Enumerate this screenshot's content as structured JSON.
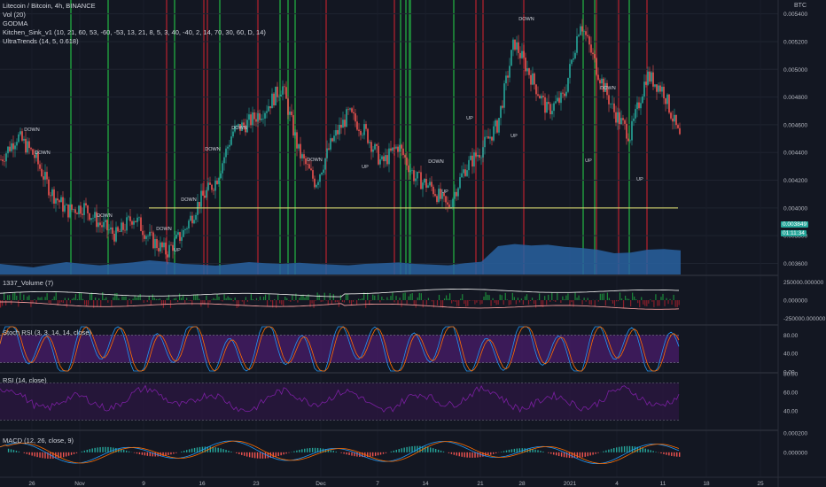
{
  "legend": {
    "symbol": "Litecoin / Bitcoin, 4h, BINANCE",
    "vol": "Vol (20)",
    "godma": "GODMA",
    "kitchen": "Kitchen_Sink_v1 (10, 21, 60, 53, -60, -53, 13, 21, 8, 5, 3, 40, -40, 2, 14, 70, 30, 60, D, 14)",
    "ultratrends": "UltraTrends (14, 5, 0.618)"
  },
  "axis_currency": "BTC",
  "panes": {
    "volume1337": "1337_Volume (7)",
    "stoch": "Stoch RSI (3, 3, 14, 14, close)",
    "rsi": "RSI (14, close)",
    "macd": "MACD (12, 26, close, 9)"
  },
  "price_tags": {
    "last_price": "0.003849",
    "countdown": "01:11:34"
  },
  "colors": {
    "background": "#131722",
    "bull": "#26a69a",
    "bear": "#ef5350",
    "green_band": "#1e8a3a",
    "red_band": "#8a1e2a",
    "volume": "#2962a0",
    "support": "#f0f07a",
    "stoch_fill": "#4a1c6b",
    "rsi_line": "#7b1fa2",
    "macd_line": "#2196f3",
    "signal_line": "#ff6d00"
  },
  "chart_data": [
    {
      "type": "line",
      "title": "Litecoin / Bitcoin, 4h, BINANCE",
      "x_ticks": [
        "26",
        "Nov",
        "9",
        "16",
        "23",
        "Dec",
        "7",
        "14",
        "21",
        "28",
        "2021",
        "4",
        "11",
        "18",
        "25"
      ],
      "y_ticks": [
        "0.005400",
        "0.005200",
        "0.005000",
        "0.004800",
        "0.004600",
        "0.004400",
        "0.004200",
        "0.004000",
        "0.003800",
        "0.003600"
      ],
      "ylim": [
        0.00352,
        0.0055
      ],
      "x_index": [
        0,
        10,
        20,
        30,
        40,
        50,
        60,
        70,
        80,
        90,
        100,
        110,
        120,
        130,
        140,
        150,
        160,
        170,
        180,
        190,
        200,
        210,
        220,
        230,
        240,
        250,
        260,
        270,
        280,
        290,
        300,
        310,
        320,
        330,
        340,
        350,
        360,
        370,
        380,
        390,
        400,
        410
      ],
      "close": [
        0.00435,
        0.00452,
        0.00438,
        0.00412,
        0.00398,
        0.00401,
        0.00388,
        0.0038,
        0.00394,
        0.00378,
        0.00368,
        0.00382,
        0.00405,
        0.0042,
        0.00455,
        0.00462,
        0.00472,
        0.00488,
        0.0044,
        0.00418,
        0.00448,
        0.00468,
        0.00455,
        0.00432,
        0.00445,
        0.00422,
        0.00415,
        0.004,
        0.00428,
        0.00442,
        0.0046,
        0.0052,
        0.00495,
        0.0047,
        0.0048,
        0.00535,
        0.005,
        0.0047,
        0.00452,
        0.00496,
        0.00485,
        0.0045
      ],
      "support_level": 0.004,
      "annotations_down": [
        "DOWN",
        "DOWN",
        "DOWN",
        "DOWN",
        "DOWN",
        "DOWN",
        "DOWN",
        "DOWN",
        "DOWN",
        "DOWN",
        "DOWN"
      ],
      "annotations_up": [
        "UP",
        "UP",
        "UP",
        "UP",
        "UP",
        "UP",
        "UP"
      ],
      "green_bands": [
        80,
        122,
        197,
        248,
        316,
        325,
        333,
        452,
        458,
        462,
        463,
        512,
        658,
        671,
        710
      ],
      "red_bands": [
        188,
        230,
        234,
        291,
        368,
        445,
        537,
        545,
        591,
        673,
        698,
        730
      ],
      "volume_profile": [
        0.3,
        0.25,
        0.2,
        0.28,
        0.35,
        0.3,
        0.26,
        0.3,
        0.34,
        0.4,
        0.36,
        0.3,
        0.28,
        0.25,
        0.3,
        0.35,
        0.32,
        0.3,
        0.33,
        0.3,
        0.28,
        0.26,
        0.3,
        0.32,
        0.34,
        0.3,
        0.28,
        0.26,
        0.32,
        0.36,
        0.8,
        0.86,
        0.82,
        0.84,
        0.78,
        0.75,
        0.7,
        0.6,
        0.62,
        0.7,
        0.72,
        0.68
      ]
    },
    {
      "type": "line",
      "title": "1337_Volume (7)",
      "y_ticks": [
        "250000.000000",
        "0.000000",
        "-250000.000000"
      ],
      "ylim": [
        -330000,
        330000
      ]
    },
    {
      "type": "line",
      "title": "Stoch RSI (3, 3, 14, 14, close)",
      "y_ticks": [
        "80.00",
        "40.00",
        "0.00"
      ],
      "ylim": [
        0,
        100
      ],
      "bands": [
        20,
        80
      ]
    },
    {
      "type": "line",
      "title": "RSI (14, close)",
      "y_ticks": [
        "80.00",
        "60.00",
        "40.00"
      ],
      "ylim": [
        20,
        80
      ],
      "bands": [
        30,
        70
      ]
    },
    {
      "type": "line",
      "title": "MACD (12, 26, close, 9)",
      "y_ticks": [
        "0.000200",
        "0.000000"
      ],
      "ylim": [
        -0.00026,
        0.00022
      ]
    }
  ]
}
